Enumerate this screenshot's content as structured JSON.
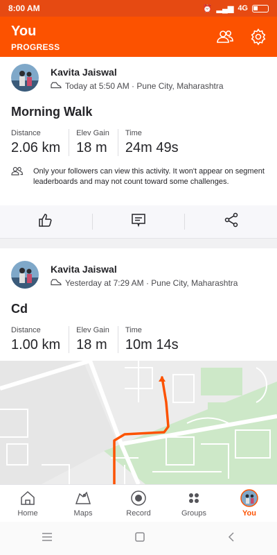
{
  "status_bar": {
    "time": "8:00 AM",
    "network": "4G"
  },
  "header": {
    "title": "You",
    "subtitle": "PROGRESS"
  },
  "activities": [
    {
      "athlete": "Kavita Jaiswal",
      "meta": "Today at 5:50 AM · Pune City, Maharashtra",
      "title": "Morning Walk",
      "stats": [
        {
          "label": "Distance",
          "value": "2.06 km"
        },
        {
          "label": "Elev Gain",
          "value": "18 m"
        },
        {
          "label": "Time",
          "value": "24m 49s"
        }
      ],
      "privacy_note": "Only your followers can view this activity. It won't appear on segment leaderboards and may not count toward some challenges."
    },
    {
      "athlete": "Kavita Jaiswal",
      "meta": "Yesterday at 7:29 AM · Pune City, Maharashtra",
      "title": "Cd",
      "stats": [
        {
          "label": "Distance",
          "value": "1.00 km"
        },
        {
          "label": "Elev Gain",
          "value": "18 m"
        },
        {
          "label": "Time",
          "value": "10m 14s"
        }
      ]
    }
  ],
  "bottom_nav": [
    {
      "label": "Home",
      "icon": "home-icon"
    },
    {
      "label": "Maps",
      "icon": "map-icon"
    },
    {
      "label": "Record",
      "icon": "record-icon"
    },
    {
      "label": "Groups",
      "icon": "groups-icon"
    },
    {
      "label": "You",
      "icon": "avatar-icon",
      "active": true
    }
  ],
  "colors": {
    "brand": "#fc5200",
    "status_bar": "#e64a12",
    "route": "#fc5200"
  }
}
